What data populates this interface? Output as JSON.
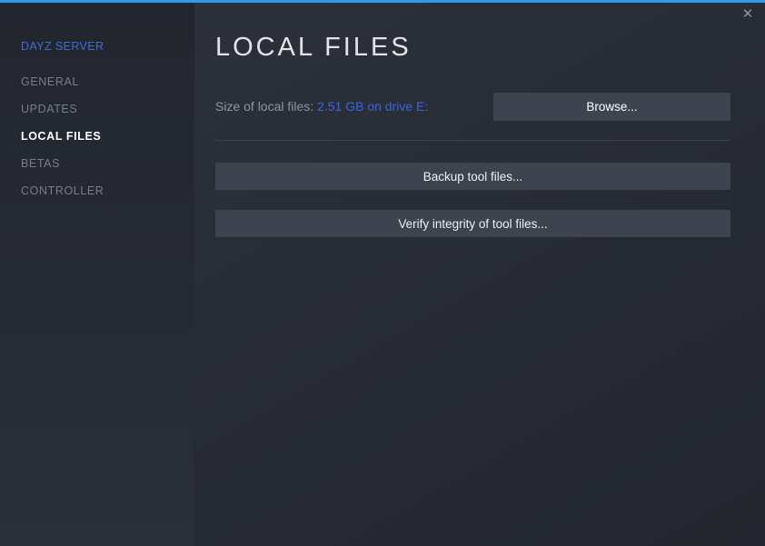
{
  "window": {
    "close_icon": "✕",
    "accent_color": "#2d9aee"
  },
  "sidebar": {
    "app_name": "DAYZ SERVER",
    "app_name_color": "#3e6dd3",
    "items": [
      {
        "label": "GENERAL",
        "active": false
      },
      {
        "label": "UPDATES",
        "active": false
      },
      {
        "label": "LOCAL FILES",
        "active": true
      },
      {
        "label": "BETAS",
        "active": false
      },
      {
        "label": "CONTROLLER",
        "active": false
      }
    ]
  },
  "main": {
    "title": "LOCAL FILES",
    "size_label": "Size of local files: ",
    "size_value": "2.51 GB on drive E:",
    "size_value_color": "#3a64e0",
    "browse_button": "Browse...",
    "backup_button": "Backup tool files...",
    "verify_button": "Verify integrity of tool files..."
  }
}
